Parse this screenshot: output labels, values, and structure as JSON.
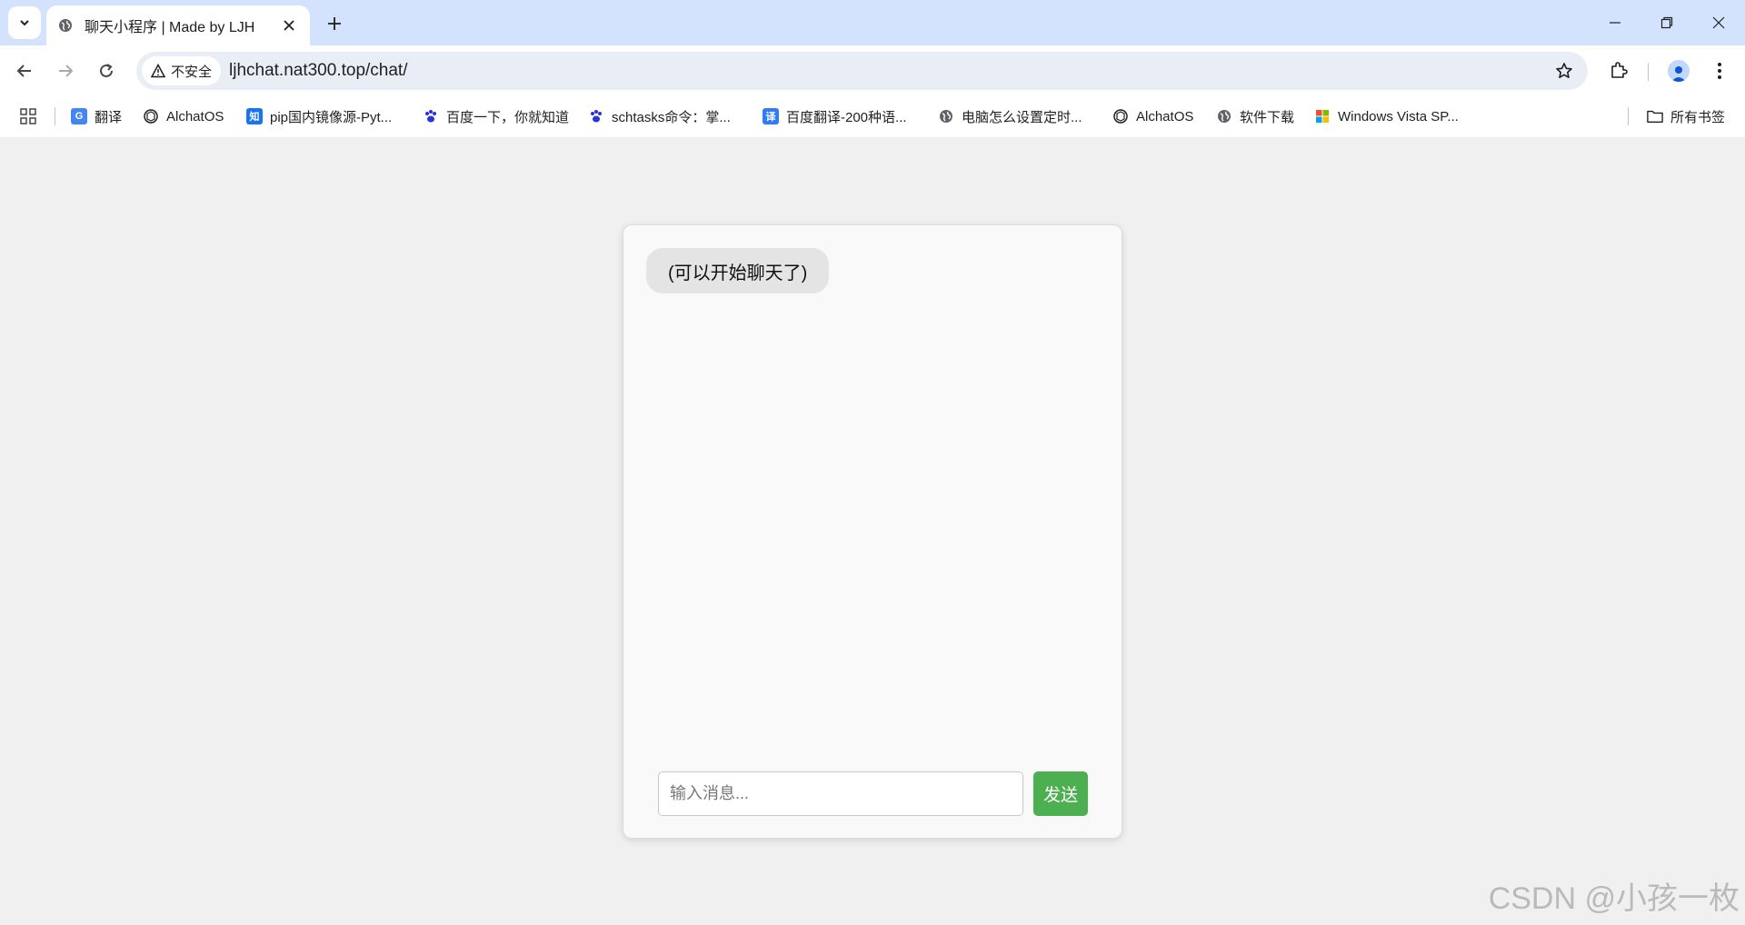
{
  "browser": {
    "tab": {
      "title": "聊天小程序 | Made by LJH",
      "favicon": "globe-icon"
    },
    "window_controls": [
      "minimize-icon",
      "restore-icon",
      "close-icon"
    ],
    "address": {
      "security_label": "不安全",
      "url": "ljhchat.nat300.top/chat/"
    },
    "bookmarks": [
      {
        "label": "翻译",
        "icon": "translate-icon",
        "color": "#4285f4"
      },
      {
        "label": "AlchatOS",
        "icon": "openai-icon",
        "color": "#1f1f1f"
      },
      {
        "label": "pip国内镜像源-Pyt...",
        "icon": "zhihu-icon",
        "glyph": "知",
        "color": "#1772f6"
      },
      {
        "label": "百度一下，你就知道",
        "icon": "baidu-paw-icon",
        "color": "#2932e1"
      },
      {
        "label": "schtasks命令：掌...",
        "icon": "baidu-paw-icon",
        "color": "#2932e1"
      },
      {
        "label": "百度翻译-200种语...",
        "icon": "baidu-translate-icon",
        "glyph": "译",
        "color": "#2f7df6"
      },
      {
        "label": "电脑怎么设置定时...",
        "icon": "globe-icon",
        "color": "#5f6368"
      },
      {
        "label": "AlchatOS",
        "icon": "openai-icon",
        "color": "#1f1f1f"
      },
      {
        "label": "软件下载",
        "icon": "globe-icon",
        "color": "#5f6368"
      },
      {
        "label": "Windows Vista SP...",
        "icon": "windows-icon",
        "color": "#f25022"
      }
    ],
    "all_bookmarks_label": "所有书签"
  },
  "chat": {
    "messages": [
      {
        "text": "(可以开始聊天了)"
      }
    ],
    "input_placeholder": "输入消息...",
    "send_label": "发送",
    "send_color": "#4caf50"
  },
  "watermark": "CSDN @小孩一枚"
}
